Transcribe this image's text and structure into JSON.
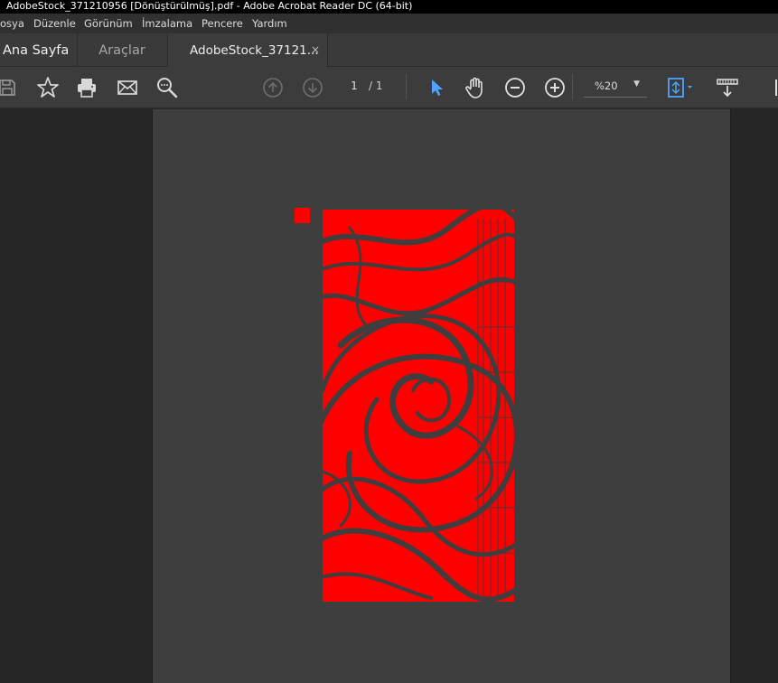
{
  "window": {
    "title": "AdobeStock_371210956 [Dönüştürülmüş].pdf - Adobe Acrobat Reader DC (64-bit)"
  },
  "menu": {
    "items": [
      "osya",
      "Düzenle",
      "Görünüm",
      "İmzalama",
      "Pencere",
      "Yardım"
    ]
  },
  "tabs": {
    "home": "Ana Sayfa",
    "tools": "Araçlar",
    "document": "AdobeStock_37121...",
    "close_symbol": "×"
  },
  "toolbar": {
    "page_current": "1",
    "page_total": "/ 1",
    "zoom_value": "%20",
    "zoom_caret": "▼",
    "icons": [
      "save-icon",
      "star-icon",
      "print-icon",
      "mail-icon",
      "search-icon",
      "page-up-icon",
      "page-down-icon",
      "select-arrow-icon",
      "hand-icon",
      "zoom-out-icon",
      "zoom-in-icon",
      "fit-page-icon",
      "scroll-mode-icon"
    ]
  },
  "colors": {
    "accent_blue": "#4da3ff",
    "artwork_red": "#ff0000",
    "canvas_bg": "#3e3e3e"
  }
}
